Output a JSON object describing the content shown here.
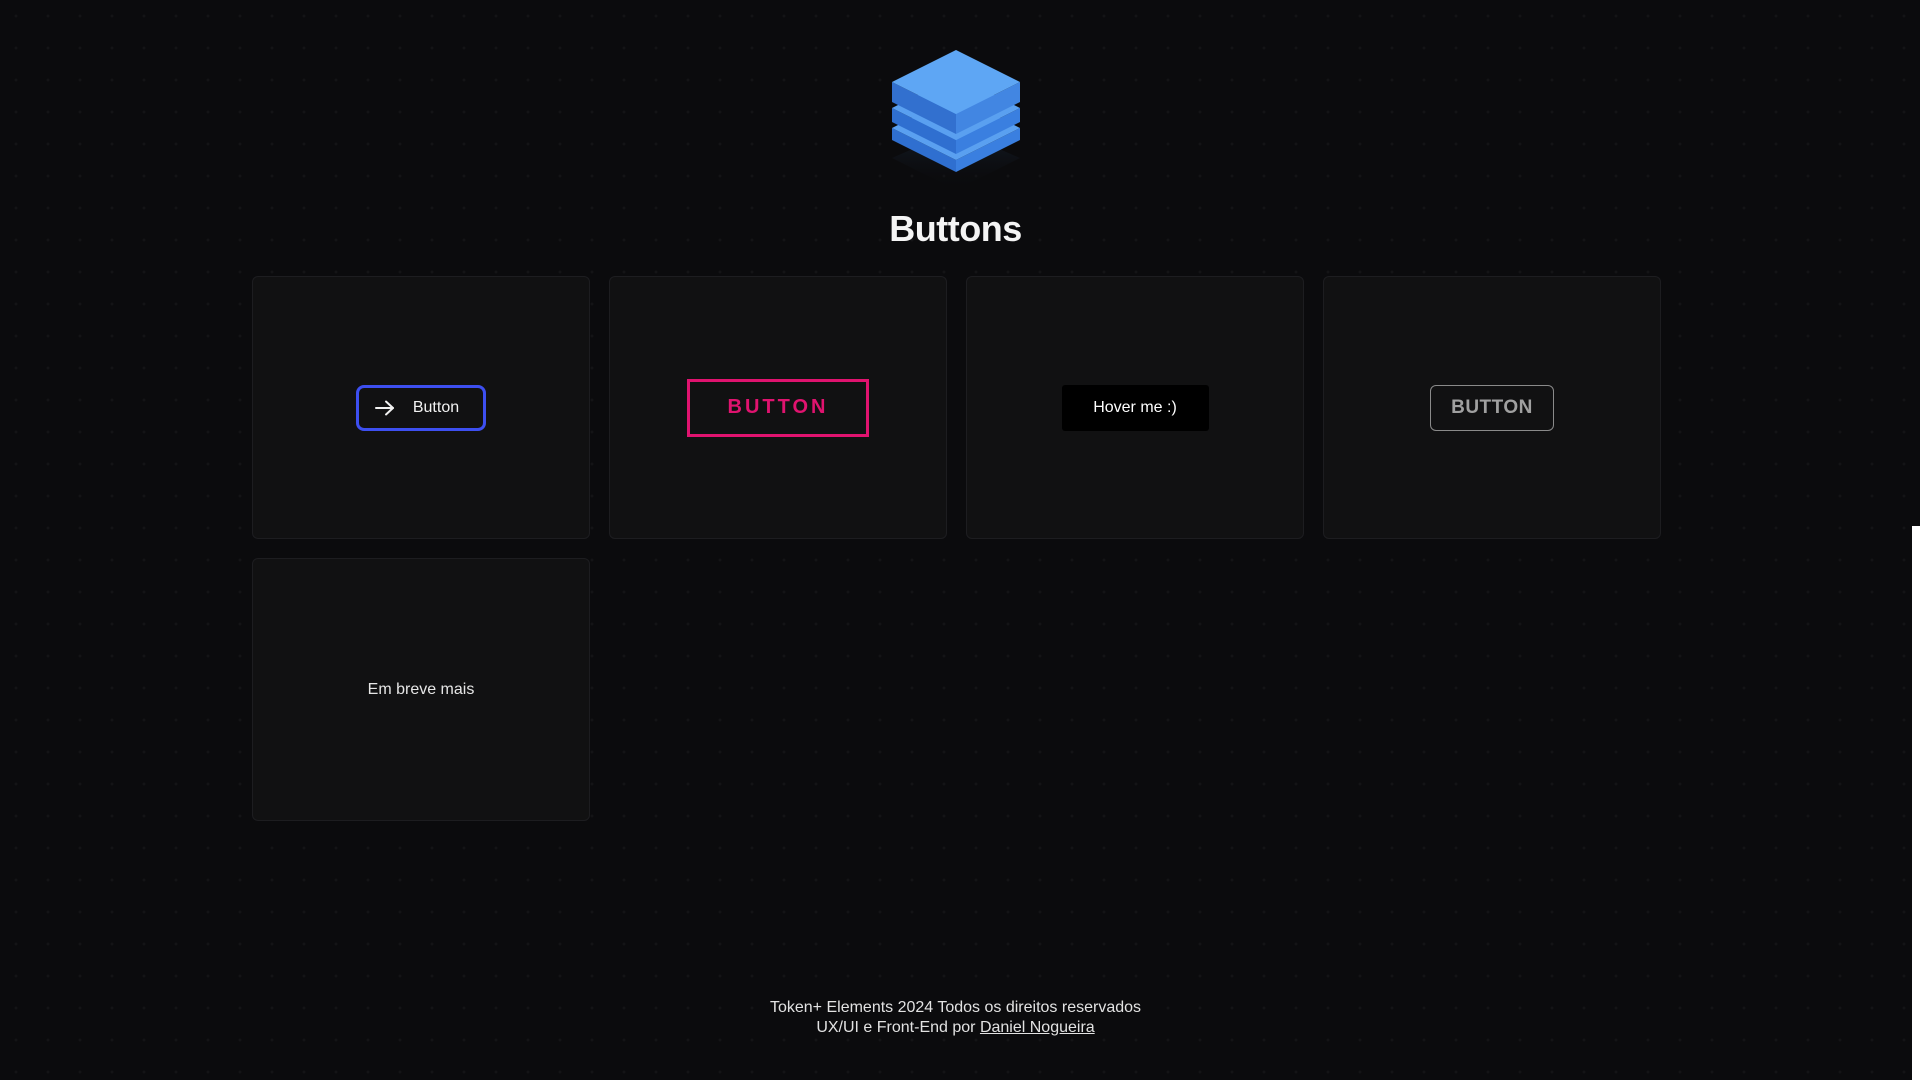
{
  "header": {
    "logo_icon": "stacked-layers-cube-icon",
    "title": "Buttons"
  },
  "colors": {
    "background": "#0b0b0d",
    "card": "#111112",
    "accent_blue": "#3d4ff0",
    "accent_pink": "#e0136f",
    "logo_blue": "#4a90e2"
  },
  "cards": [
    {
      "button_label": "Button",
      "icon": "arrow-right-icon"
    },
    {
      "button_label": "BUTTON"
    },
    {
      "button_label": "Hover me :)"
    },
    {
      "button_label": "BUTTON"
    },
    {
      "text": "Em breve mais"
    }
  ],
  "footer": {
    "line1": "Token+ Elements 2024 Todos os direitos reservados",
    "line2_prefix": "UX/UI e Front-End por",
    "author_link": "Daniel Nogueira"
  }
}
